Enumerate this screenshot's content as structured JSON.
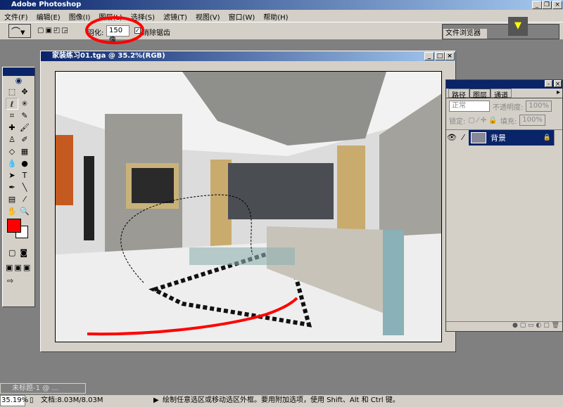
{
  "app": {
    "title": "Adobe Photoshop"
  },
  "menu": [
    "文件(F)",
    "编辑(E)",
    "图像(I)",
    "图层(L)",
    "选择(S)",
    "滤镜(T)",
    "视图(V)",
    "窗口(W)",
    "帮助(H)"
  ],
  "options": {
    "feather_label": "羽化:",
    "feather_value": "150 像",
    "antialias_label": "消除锯齿",
    "antialias_checked": true,
    "file_browser_tab": "文件浏览器"
  },
  "document": {
    "title": "家装练习01.tga @ 35.2%(RGB)"
  },
  "layers_panel": {
    "tabs": [
      "路径",
      "图层",
      "通道"
    ],
    "active_tab": "图层",
    "blend_mode": "正常",
    "opacity_label": "不透明度:",
    "opacity": "100%",
    "lock_label": "锁定:",
    "fill_label": "填充:",
    "fill": "100%",
    "layers": [
      {
        "name": "背景",
        "locked": true,
        "visible": true
      }
    ]
  },
  "minimized_doc": {
    "title": "未标题-1 @ ..."
  },
  "status": {
    "zoom": "35.19%",
    "doc_size": "文档:8.03M/8.03M",
    "hint": "绘制任意选区或移动选区外框。要用附加选项，使用 Shift、Alt 和 Ctrl 键。"
  },
  "colors": {
    "foreground": "#ff0000",
    "background": "#ffffff",
    "annotation": "#ff0000",
    "titlebar": "#0a246a"
  }
}
